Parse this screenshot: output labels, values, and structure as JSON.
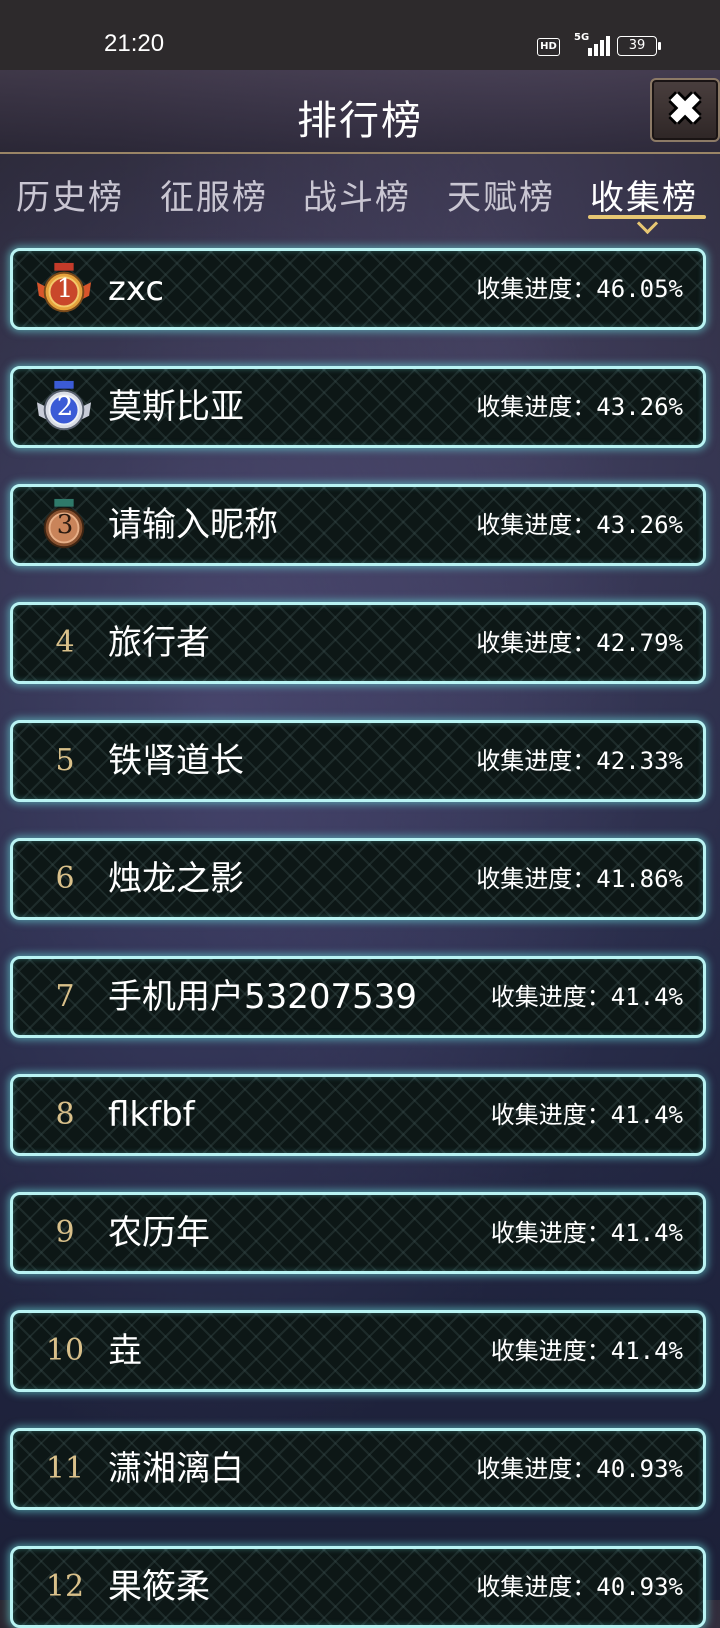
{
  "status_bar": {
    "time": "21:20",
    "hd": "HD",
    "network": "5G",
    "battery": "39"
  },
  "header": {
    "title": "排行榜"
  },
  "tabs": [
    {
      "label": "历史榜",
      "active": false
    },
    {
      "label": "征服榜",
      "active": false
    },
    {
      "label": "战斗榜",
      "active": false
    },
    {
      "label": "天赋榜",
      "active": false
    },
    {
      "label": "收集榜",
      "active": true
    }
  ],
  "colors": {
    "row_border": "#b9f3f3",
    "tab_active_underline": "#e7c773",
    "rank_text": "#d9c08a",
    "medal_gold": "#d8552b",
    "medal_silver": "#3b5bd6",
    "medal_bronze": "#b86a3c"
  },
  "rows": [
    {
      "rank": "1",
      "medal": "gold-medal-icon",
      "name": "zxc",
      "progress": "收集进度：46.05%"
    },
    {
      "rank": "2",
      "medal": "silver-medal-icon",
      "name": "莫斯比亚",
      "progress": "收集进度：43.26%"
    },
    {
      "rank": "3",
      "medal": "bronze-medal-icon",
      "name": "请输入昵称",
      "progress": "收集进度：43.26%"
    },
    {
      "rank": "4",
      "name": "旅行者",
      "progress": "收集进度：42.79%"
    },
    {
      "rank": "5",
      "name": "铁肾道长",
      "progress": "收集进度：42.33%"
    },
    {
      "rank": "6",
      "name": "烛龙之影",
      "progress": "收集进度：41.86%"
    },
    {
      "rank": "7",
      "name": "手机用户53207539",
      "progress": "收集进度：41.4%"
    },
    {
      "rank": "8",
      "name": "flkfbf",
      "progress": "收集进度：41.4%"
    },
    {
      "rank": "9",
      "name": "农历年",
      "progress": "收集进度：41.4%"
    },
    {
      "rank": "10",
      "name": "垚",
      "progress": "收集进度：41.4%"
    },
    {
      "rank": "11",
      "name": "潇湘漓白",
      "progress": "收集进度：40.93%"
    },
    {
      "rank": "12",
      "name": "果筱柔",
      "progress": "收集进度：40.93%"
    }
  ]
}
